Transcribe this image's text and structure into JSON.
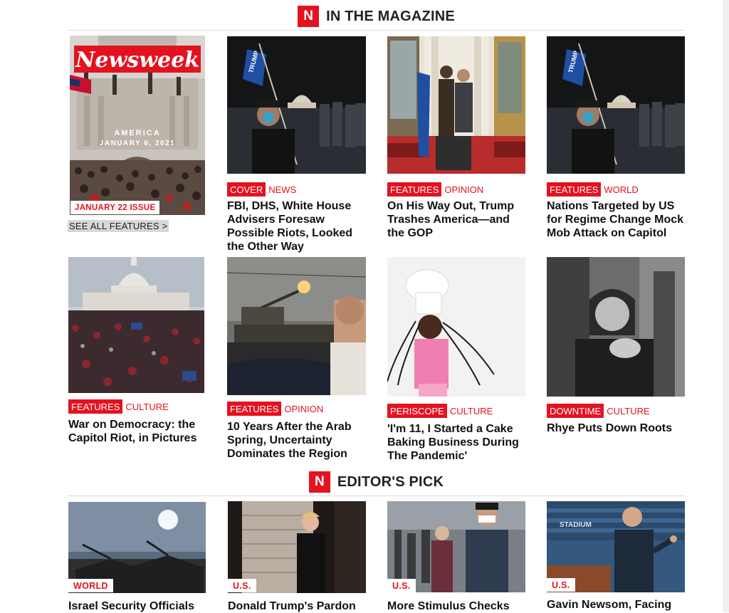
{
  "sections": {
    "magazine": {
      "logo": "N",
      "title": "IN THE MAGAZINE"
    },
    "editors_pick": {
      "logo": "N",
      "title": "EDITOR'S PICK"
    }
  },
  "cover": {
    "masthead": "Newsweek",
    "overlay_line1": "AMERICA",
    "overlay_line2": "JANUARY 6, 2021",
    "issue_label": "JANUARY 22 ISSUE",
    "see_all": "SEE ALL FEATURES >"
  },
  "magazine_cards": [
    {
      "tag1": "COVER",
      "tag2": "NEWS",
      "headline": "FBI, DHS, White House Advisers Foresaw Possible Riots, Looked the Other Way",
      "image": "rioter-with-flag-capitol-night"
    },
    {
      "tag1": "FEATURES",
      "tag2": "OPINION",
      "headline": "On His Way Out, Trump Trashes America—and the GOP",
      "image": "rioters-in-rotunda"
    },
    {
      "tag1": "FEATURES",
      "tag2": "WORLD",
      "headline": "Nations Targeted by US for Regime Change Mock Mob Attack on Capitol",
      "image": "rioter-with-flag-capitol-night"
    },
    {
      "tag1": "FEATURES",
      "tag2": "CULTURE",
      "headline": "War on Democracy: the Capitol Riot, in Pictures",
      "image": "crowd-at-capitol"
    },
    {
      "tag1": "FEATURES",
      "tag2": "OPINION",
      "headline": "10 Years After the Arab Spring, Uncertainty Dominates the Region",
      "image": "anti-aircraft-gun-firing"
    },
    {
      "tag1": "PERISCOPE",
      "tag2": "CULTURE",
      "headline": "'I'm 11, I Started a Cake Baking Business During The Pandemic'",
      "image": "girl-in-chef-hat"
    },
    {
      "tag1": "DOWNTIME",
      "tag2": "CULTURE",
      "headline": "Rhye Puts Down Roots",
      "image": "musician-portrait-bw"
    }
  ],
  "editor_cards": [
    {
      "tag": "WORLD",
      "headline": "Israel Security Officials",
      "image": "tanks-at-sunset"
    },
    {
      "tag": "U.S.",
      "headline": "Donald Trump's Pardon",
      "image": "trump-walking-stairs"
    },
    {
      "tag": "U.S.",
      "headline": "More Stimulus Checks",
      "image": "people-in-line-masks"
    },
    {
      "tag": "U.S.",
      "headline": "Gavin Newsom, Facing",
      "image": "newsom-at-podium"
    }
  ],
  "colors": {
    "brand_red": "#e4121f"
  }
}
